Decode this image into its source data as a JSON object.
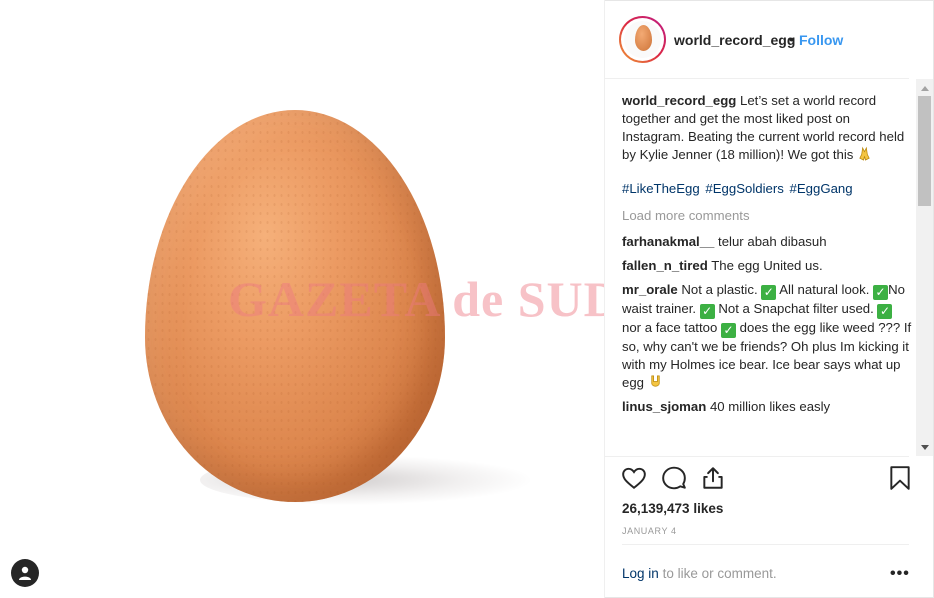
{
  "media": {
    "watermark": "GAZETA de SUD"
  },
  "header": {
    "username": "world_record_egg",
    "separator": "•",
    "follow_label": "Follow"
  },
  "caption": {
    "username": "world_record_egg",
    "text": "Let’s set a world record together and get the most liked post on Instagram. Beating the current world record held by Kylie Jenner (18 million)! We got this",
    "hashtags": [
      "#LikeTheEgg",
      "#EggSoldiers",
      "#EggGang"
    ]
  },
  "load_more": "Load more comments",
  "comments": [
    {
      "username": "farhanakmal__",
      "text": "telur abah dibasuh"
    },
    {
      "username": "fallen_n_tired",
      "text": "The egg United us."
    },
    {
      "username": "mr_orale",
      "parts": [
        "Not a plastic.",
        "All natural look.",
        "No waist trainer.",
        "Not a Snapchat filter used.",
        "nor a face tattoo",
        "does the egg like weed ??? If so, why can't we be friends? Oh plus Im kicking it with my Holmes ice bear. Ice bear says what up egg"
      ]
    },
    {
      "username": "linus_sjoman",
      "text": "40 million likes easly"
    }
  ],
  "likes": "26,139,473 likes",
  "date": "JANUARY 4",
  "login": {
    "link": "Log in",
    "suffix": "to like or comment.",
    "more": "•••"
  },
  "icons": {
    "like": "heart-icon",
    "comment": "comment-icon",
    "share": "share-icon",
    "save": "bookmark-icon",
    "user": "user-icon"
  },
  "colors": {
    "link_blue": "#3897f0",
    "hashtag": "#003569",
    "muted": "#999999",
    "check_green": "#3cb043"
  }
}
